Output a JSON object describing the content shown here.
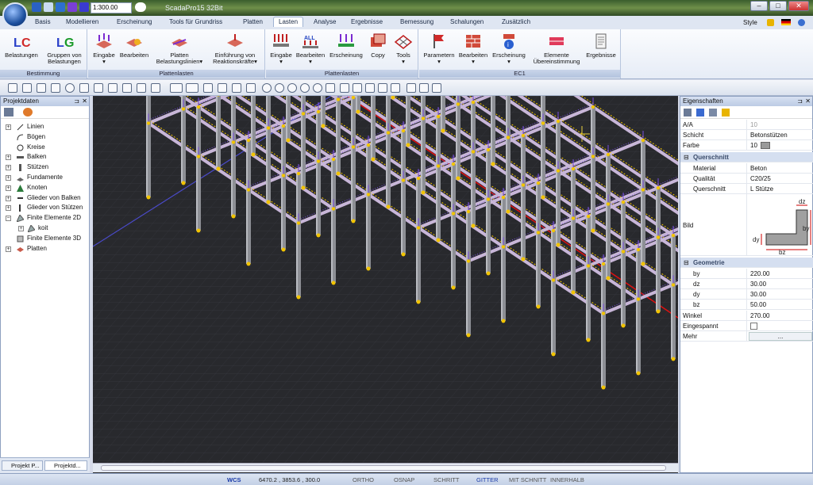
{
  "titlebar": {
    "app_title": "ScadaPro15 32Bit",
    "zoom": "1:300.00"
  },
  "window_controls": {
    "min": "–",
    "max": "□",
    "close": "✕"
  },
  "tabs": [
    "Basis",
    "Modellieren",
    "Erscheinung",
    "Tools für Grundriss",
    "Platten",
    "Lasten",
    "Analyse",
    "Ergebnisse",
    "Bemessung",
    "Schalungen",
    "Zusätzlich"
  ],
  "active_tab": "Lasten",
  "style_label": "Style",
  "ribbon": {
    "groups": [
      {
        "label": "Bestimmung",
        "buttons": [
          "Belastungen",
          "Gruppen von Belastungen"
        ]
      },
      {
        "label": "Plattenlasten",
        "buttons": [
          "Eingabe",
          "Bearbeiten",
          "Platten Belastungslinien",
          "Einführung von Reaktionskräfte"
        ]
      },
      {
        "label": "Plattenlasten",
        "buttons": [
          "Eingabe",
          "Bearbeiten",
          "Erscheinung",
          "Copy",
          "Tools"
        ]
      },
      {
        "label": "EC1",
        "buttons": [
          "Parametern",
          "Bearbeiten",
          "Erscheinung",
          "Elemente Übereinstimmung",
          "Ergebnisse"
        ]
      }
    ]
  },
  "left_panel": {
    "title": "Projektdaten",
    "tree": [
      "Linien",
      "Bögen",
      "Kreise",
      "Balken",
      "Stützen",
      "Fundamente",
      "Knoten",
      "Glieder von Balken",
      "Glieder von Stützen",
      "Finite Elemente 2D",
      "koit",
      "Finite Elemente 3D",
      "Platten"
    ],
    "bottom_tabs": [
      "Projekt P...",
      "Projektd..."
    ]
  },
  "properties": {
    "title": "Eigenschaften",
    "rows": [
      {
        "name": "A/A",
        "value": "10"
      },
      {
        "name": "Schicht",
        "value": "Betonstützen"
      },
      {
        "name": "Farbe",
        "value": "10"
      }
    ],
    "section1": "Querschnitt",
    "rows2": [
      {
        "name": "Material",
        "value": "Beton"
      },
      {
        "name": "Qualität",
        "value": "C20/25"
      },
      {
        "name": "Querschnitt",
        "value": "L Stütze"
      }
    ],
    "bild_label": "Bild",
    "dims": {
      "dz": "dz",
      "dy": "dy",
      "by": "by",
      "bz": "bz"
    },
    "section2": "Geometrie",
    "rows3": [
      {
        "name": "by",
        "value": "220.00"
      },
      {
        "name": "dz",
        "value": "30.00"
      },
      {
        "name": "dy",
        "value": "30.00"
      },
      {
        "name": "bz",
        "value": "50.00"
      }
    ],
    "rows4": [
      {
        "name": "Winkel",
        "value": "270.00"
      },
      {
        "name": "Eingespannt",
        "value": ""
      },
      {
        "name": "Mehr",
        "value": "..."
      }
    ]
  },
  "status": {
    "wcs": "WCS",
    "coords": "6470.2 , 3853.6 , 300.0",
    "items": [
      "ORTHO",
      "OSNAP",
      "SCHRITT",
      "GITTER",
      "MIT SCHNITT",
      "INNERHALB"
    ],
    "active": "GITTER"
  },
  "colors": {
    "accent": "#2a53c8",
    "slab_beam": "#c8b6d8",
    "load": "#7a4fe0",
    "node": "#f2c400",
    "axis_red": "#e01010",
    "axis_blue": "#4a4ac8",
    "viewport_bg": "#28292d"
  }
}
